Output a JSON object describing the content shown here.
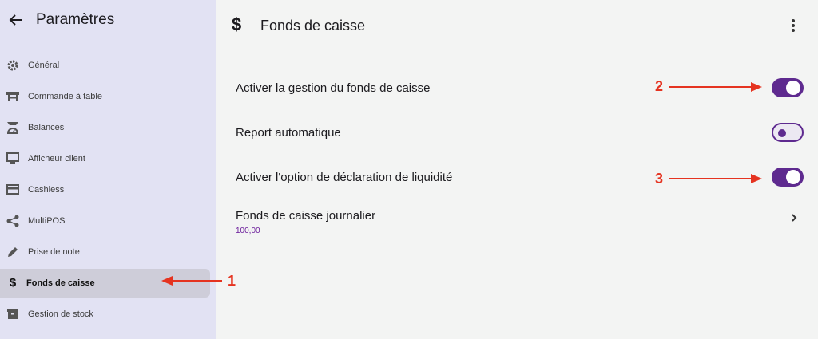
{
  "sidebar": {
    "title": "Paramètres",
    "items": [
      {
        "label": "Général",
        "icon": "gear-icon"
      },
      {
        "label": "Commande à table",
        "icon": "table-icon"
      },
      {
        "label": "Balances",
        "icon": "scale-icon"
      },
      {
        "label": "Afficheur client",
        "icon": "monitor-icon"
      },
      {
        "label": "Cashless",
        "icon": "credit-card-icon"
      },
      {
        "label": "MultiPOS",
        "icon": "share-icon"
      },
      {
        "label": "Prise de note",
        "icon": "pencil-icon"
      },
      {
        "label": "Fonds de caisse",
        "icon": "dollar-icon",
        "active": true
      },
      {
        "label": "Gestion de stock",
        "icon": "archive-icon"
      }
    ]
  },
  "main": {
    "title": "Fonds de caisse",
    "settings": [
      {
        "label": "Activer la gestion du fonds de caisse",
        "state": "on"
      },
      {
        "label": "Report automatique",
        "state": "off"
      },
      {
        "label": "Activer l'option de déclaration de liquidité",
        "state": "on"
      },
      {
        "label": "Fonds de caisse journalier",
        "value": "100,00"
      }
    ]
  },
  "annotations": [
    "1",
    "2",
    "3"
  ],
  "colors": {
    "accent": "#5e2a8f",
    "annotation": "#e53320",
    "sidebar_bg": "#e2e2f3",
    "main_bg": "#f3f4f3"
  }
}
